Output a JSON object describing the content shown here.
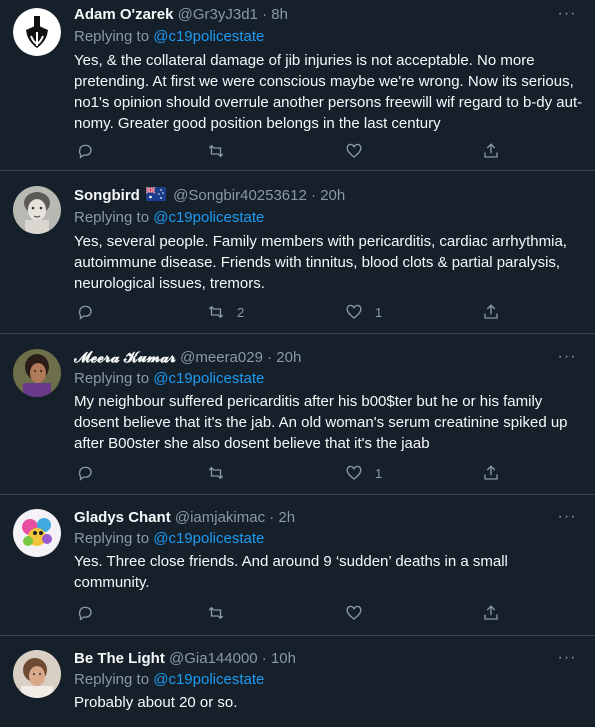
{
  "tweets": [
    {
      "name": "Adam O'zarek",
      "handle": "@Gr3yJ3d1",
      "time": "8h",
      "replying_label": "Replying to",
      "replying_to": "@c19policestate",
      "text": "Yes, & the collateral damage of jib injuries is not acceptable. No more pretending. At first we were conscious maybe we're wrong. Now its serious, no1's opinion should overrule another persons freewill wif regard to b-dy aut-nomy. Greater good position belongs in the last century",
      "retweets": "",
      "likes": ""
    },
    {
      "name": "Songbird",
      "handle": "@Songbir40253612",
      "time": "20h",
      "replying_label": "Replying to",
      "replying_to": "@c19policestate",
      "text": "Yes, several people. Family members with pericarditis, cardiac arrhythmia, autoimmune disease. Friends with tinnitus, blood clots & partial paralysis, neurological issues, tremors.",
      "retweets": "2",
      "likes": "1"
    },
    {
      "name": "𝓜𝓮𝓮𝓻𝓪 𝓚𝓾𝓶𝓪𝓻",
      "handle": "@meera029",
      "time": "20h",
      "replying_label": "Replying to",
      "replying_to": "@c19policestate",
      "text": "My neighbour suffered pericarditis after his b00$ter but he or his family dosent believe that it's the jab. An old woman's serum creatinine spiked up after B00ster she also dosent believe that it's the jaab",
      "retweets": "",
      "likes": "1"
    },
    {
      "name": "Gladys Chant",
      "handle": "@iamjakimac",
      "time": "2h",
      "replying_label": "Replying to",
      "replying_to": "@c19policestate",
      "text": "Yes. Three close friends. And around 9 ‘sudden’ deaths in a small community.",
      "retweets": "",
      "likes": ""
    },
    {
      "name": "Be The Light",
      "handle": "@Gia144000",
      "time": "10h",
      "replying_label": "Replying to",
      "replying_to": "@c19policestate",
      "text": "Probably about 20 or so.",
      "retweets": "",
      "likes": ""
    }
  ],
  "icons": {
    "reply": "reply-icon",
    "retweet": "retweet-icon",
    "like": "like-icon",
    "share": "share-icon",
    "more": "more-icon",
    "flag": "australia-flag-icon"
  },
  "colors": {
    "background": "#15202b",
    "text": "#f7f9f9",
    "muted": "#8b98a5",
    "link": "#1d9bf0",
    "divider": "#38444d"
  }
}
